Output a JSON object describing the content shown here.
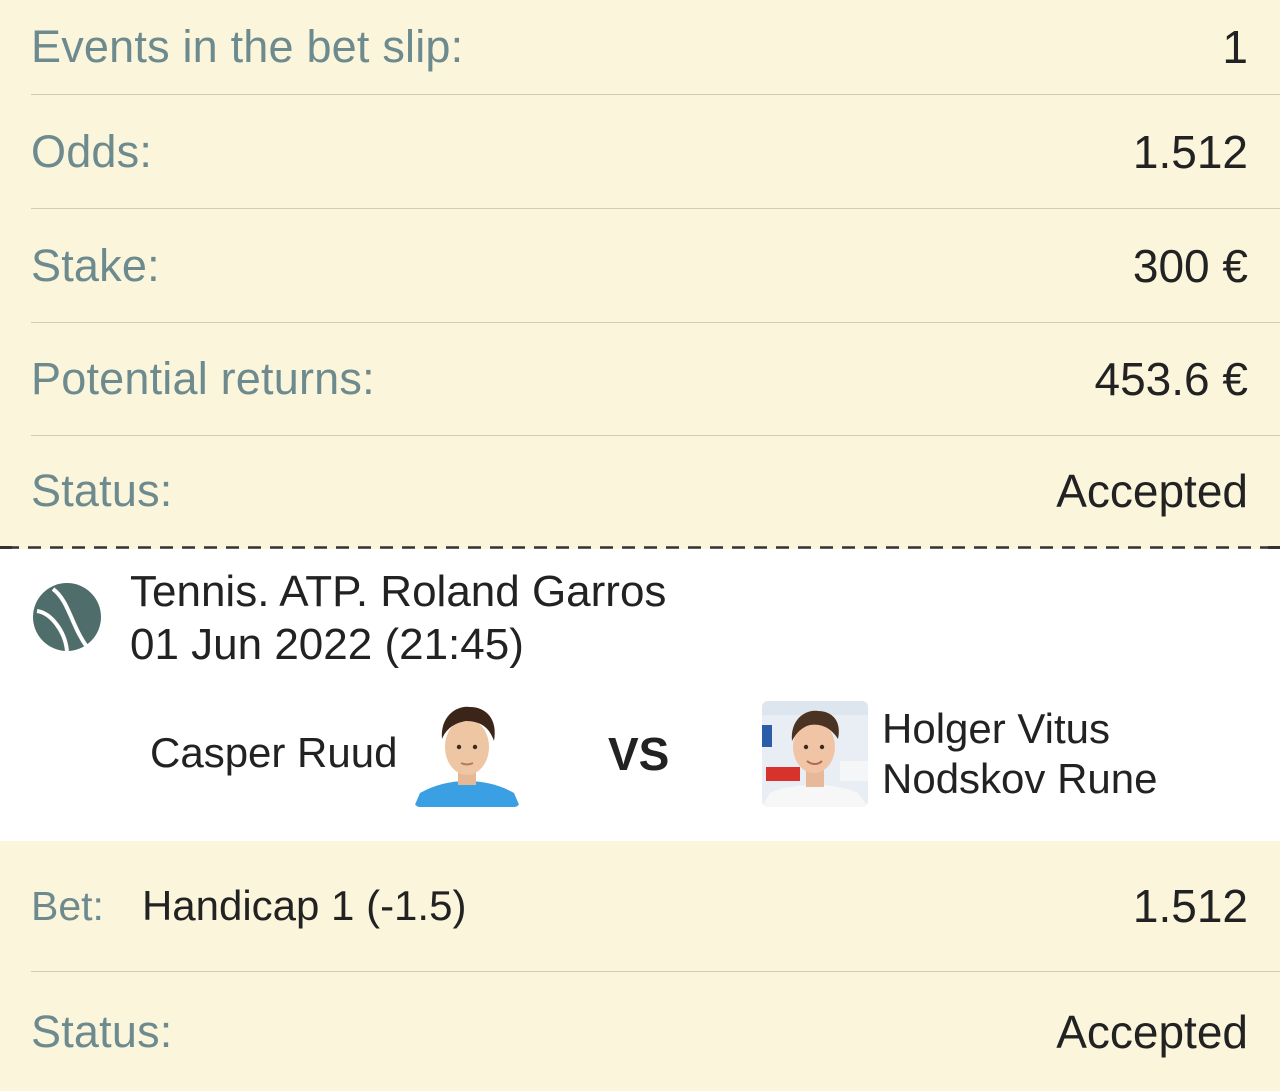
{
  "summary": {
    "events_label": "Events in the bet slip:",
    "events_value": "1",
    "odds_label": "Odds:",
    "odds_value": "1.512",
    "stake_label": "Stake:",
    "stake_value": "300 €",
    "returns_label": "Potential returns:",
    "returns_value": "453.6 €",
    "status_label": "Status:",
    "status_value": "Accepted"
  },
  "event": {
    "sport_icon": "tennis-ball-icon",
    "title": "Tennis. ATP. Roland Garros",
    "date": "01 Jun 2022 (21:45)",
    "team1": "Casper Ruud",
    "vs": "VS",
    "team2_line1": "Holger Vitus",
    "team2_line2": "Nodskov Rune"
  },
  "bet": {
    "bet_label": "Bet:",
    "bet_value": "Handicap 1 (-1.5)",
    "bet_odds": "1.512",
    "status_label": "Status:",
    "status_value": "Accepted"
  },
  "colors": {
    "background": "#fbf5dc",
    "label": "#6d8b8e",
    "value": "#222222",
    "icon": "#4f6d6b"
  }
}
